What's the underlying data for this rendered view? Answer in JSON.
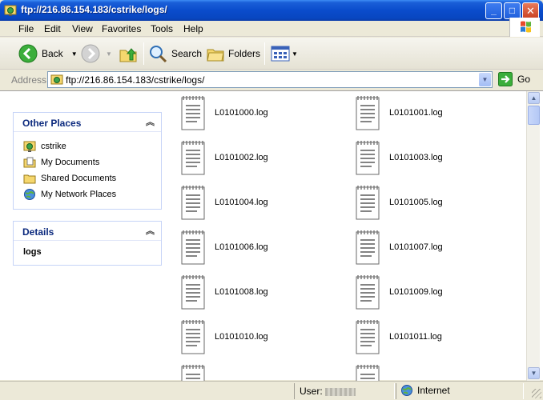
{
  "window": {
    "title": "ftp://216.86.154.183/cstrike/logs/"
  },
  "menu": [
    "File",
    "Edit",
    "View",
    "Favorites",
    "Tools",
    "Help"
  ],
  "toolbar": {
    "back": "Back",
    "search": "Search",
    "folders": "Folders"
  },
  "address": {
    "label": "Address",
    "value": "ftp://216.86.154.183/cstrike/logs/",
    "go": "Go"
  },
  "other_places": {
    "title": "Other Places",
    "items": [
      "cstrike",
      "My Documents",
      "Shared Documents",
      "My Network Places"
    ]
  },
  "details": {
    "title": "Details",
    "name": "logs"
  },
  "files": [
    "L0101000.log",
    "L0101001.log",
    "L0101002.log",
    "L0101003.log",
    "L0101004.log",
    "L0101005.log",
    "L0101006.log",
    "L0101007.log",
    "L0101008.log",
    "L0101009.log",
    "L0101010.log",
    "L0101011.log"
  ],
  "status": {
    "user_label": "User:",
    "zone": "Internet"
  }
}
